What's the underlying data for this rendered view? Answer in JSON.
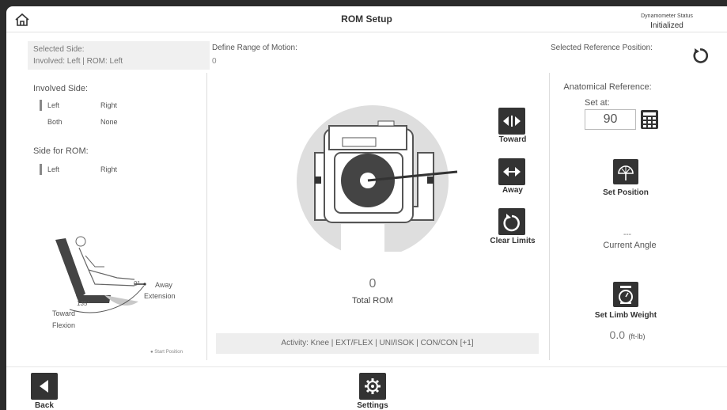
{
  "header": {
    "title": "ROM Setup",
    "dyn_label": "Dynamometer Status",
    "dyn_value": "Initialized"
  },
  "left": {
    "selected_side_label": "Selected Side:",
    "selected_side_value": "Involved: Left | ROM: Left",
    "involved_title": "Involved Side:",
    "involved_opts": [
      "Left",
      "Right",
      "Both",
      "None"
    ],
    "rom_side_title": "Side for ROM:",
    "rom_side_opts": [
      "Left",
      "Right"
    ],
    "diagram": {
      "zero": "0°",
      "away": "Away",
      "extension": "Extension",
      "deg135": "135°",
      "toward": "Toward",
      "flexion": "Flexion",
      "start": "Start Position"
    }
  },
  "center": {
    "define_label": "Define Range of Motion:",
    "define_value": "0",
    "total_value": "0",
    "total_label": "Total ROM",
    "activity": "Activity:  Knee | EXT/FLEX | UNI/ISOK | CON/CON  [+1]"
  },
  "controls": {
    "toward": "Toward",
    "away": "Away",
    "clear": "Clear Limits"
  },
  "right": {
    "ref_pos_label": "Selected Reference Position:",
    "anat_label": "Anatomical Reference:",
    "set_at": "Set at:",
    "ref_value": "90",
    "set_position": "Set Position",
    "angle_value": "---",
    "angle_label": "Current Angle",
    "set_limb": "Set Limb Weight",
    "limb_value": "0.0",
    "limb_unit": "(ft-lb)"
  },
  "footer": {
    "back": "Back",
    "settings": "Settings"
  }
}
